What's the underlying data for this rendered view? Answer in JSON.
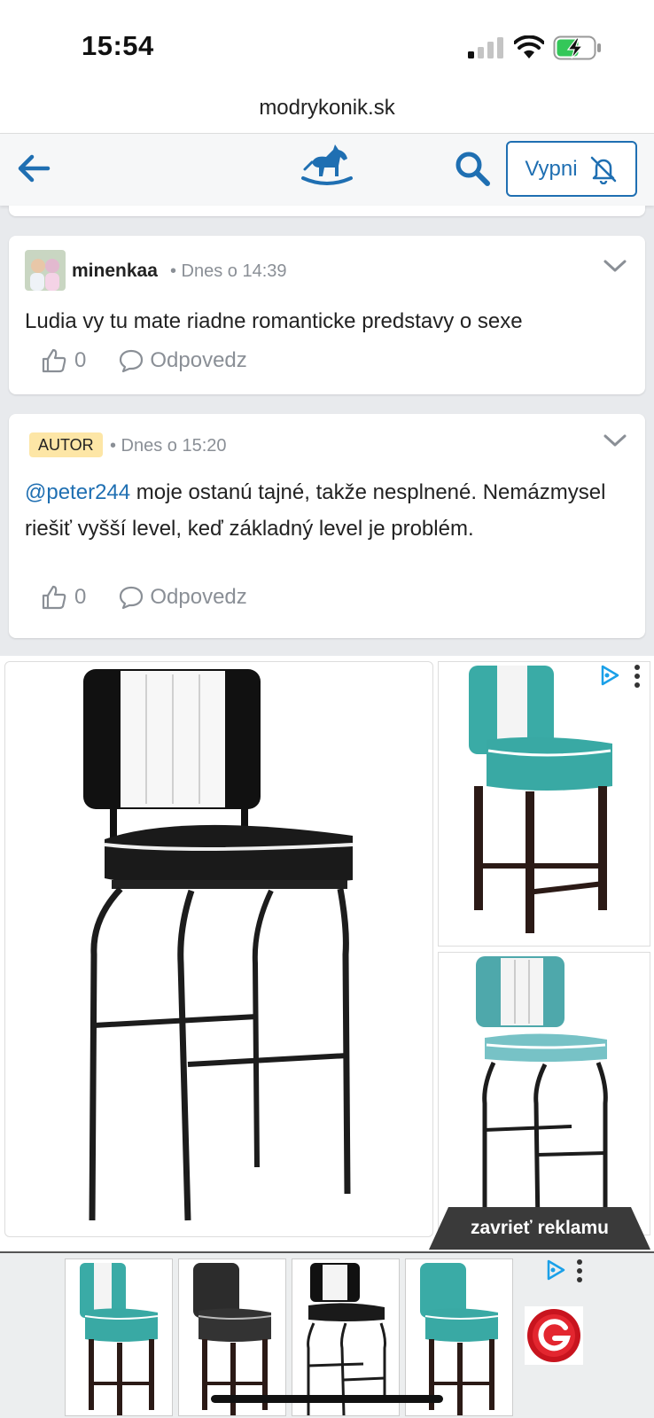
{
  "status_bar": {
    "time": "15:54",
    "icons": [
      "cellular-signal-icon",
      "wifi-icon",
      "battery-charging-icon"
    ]
  },
  "browser": {
    "url": "modrykonik.sk"
  },
  "navbar": {
    "back_icon": "arrow-left-icon",
    "logo_icon": "rocking-horse-icon",
    "search_icon": "search-icon",
    "mute_button_label": "Vypni",
    "mute_icon": "bell-off-icon",
    "accent_color": "#1f6fb2"
  },
  "comments": [
    {
      "username": "minenkaa",
      "meta": "• Dnes o 14:39",
      "text": "Ludia vy tu mate riadne romanticke predstavy o sexe",
      "likes": "0",
      "reply_label": "Odpovedz"
    },
    {
      "badge": "AUTOR",
      "meta": "• Dnes o 15:20",
      "mention": "@peter244",
      "text": " moje ostanú tajné, takže nesplnené. Nemázmysel riešiť vyšší level, keď základný level je problém.",
      "likes": "0",
      "reply_label": "Odpovedz"
    }
  ],
  "ad": {
    "close_label": "zavrieť reklamu",
    "adchoices_icon": "adchoices-icon",
    "menu_icon": "kebab-menu-icon",
    "products": [
      "black-white-bar-stool",
      "teal-bar-stool",
      "teal-white-bar-stool"
    ],
    "bottom_products": [
      "teal-white-stool",
      "black-stool",
      "black-white-stool",
      "teal-stool"
    ],
    "brand_icon": "g-brand-logo-icon"
  }
}
